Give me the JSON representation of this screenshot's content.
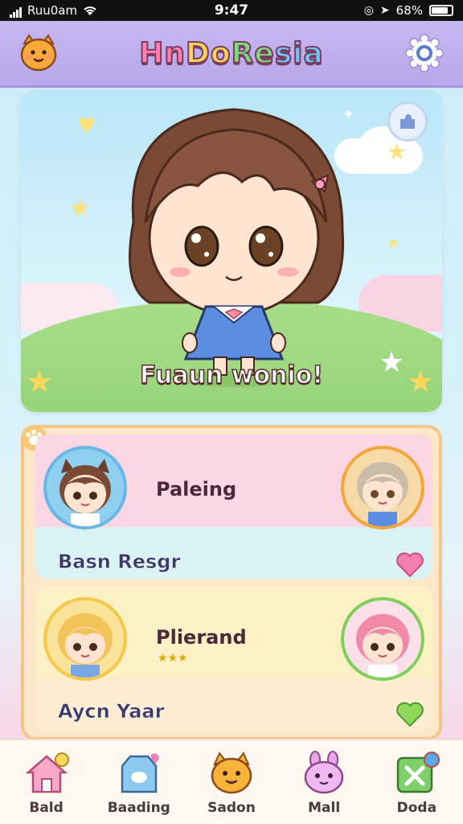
{
  "status_bar": {
    "carrier": "Ruu0am",
    "time": "9:47",
    "battery": "68%"
  },
  "header": {
    "title_parts": [
      "Hn",
      "Do",
      "Re",
      "sia"
    ]
  },
  "hero": {
    "caption": "Fuaun wonio!"
  },
  "cards": [
    {
      "name": "Paleing",
      "subtitle": "Basn Resgr",
      "stars": ""
    },
    {
      "name": "Plierand",
      "subtitle": "Aycn Yaar",
      "stars": "★★★"
    }
  ],
  "nav": [
    {
      "label": "Bald",
      "icon": "house-icon"
    },
    {
      "label": "Baading",
      "icon": "bag-icon"
    },
    {
      "label": "Sadon",
      "icon": "cat-face-icon"
    },
    {
      "label": "Mall",
      "icon": "bunny-face-icon"
    },
    {
      "label": "Doda",
      "icon": "grid-icon"
    }
  ],
  "colors": {
    "header": "#b9a8ea",
    "accent_pink": "#ff7fb0",
    "heart_pink": "#f27fb0",
    "heart_green": "#8fd85a"
  }
}
